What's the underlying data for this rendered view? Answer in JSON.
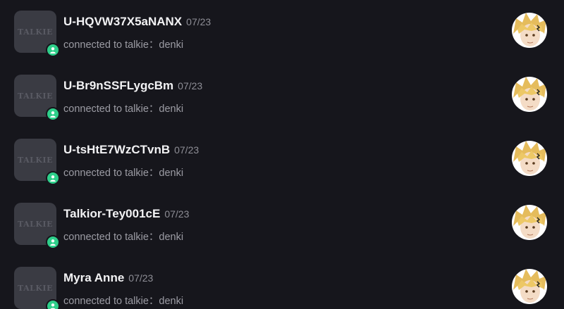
{
  "app_logo_text": "TALKIE",
  "status_icon": "online-person-icon",
  "colors": {
    "background": "#16161c",
    "status_online": "#2ecf8a",
    "name": "#f2f2f4",
    "secondary_text": "#9c9ca4"
  },
  "conversations": [
    {
      "name": "U-HQVW37X5aNANX",
      "date": "07/23",
      "message": "connected to talkie：denki",
      "avatar": "denki-character-avatar"
    },
    {
      "name": "U-Br9nSSFLygcBm",
      "date": "07/23",
      "message": "connected to talkie：denki",
      "avatar": "denki-character-avatar"
    },
    {
      "name": "U-tsHtE7WzCTvnB",
      "date": "07/23",
      "message": "connected to talkie：denki",
      "avatar": "denki-character-avatar"
    },
    {
      "name": "Talkior-Tey001cE",
      "date": "07/23",
      "message": "connected to talkie：denki",
      "avatar": "denki-character-avatar"
    },
    {
      "name": "Myra Anne",
      "date": "07/23",
      "message": "connected to talkie：denki",
      "avatar": "denki-character-avatar"
    }
  ]
}
